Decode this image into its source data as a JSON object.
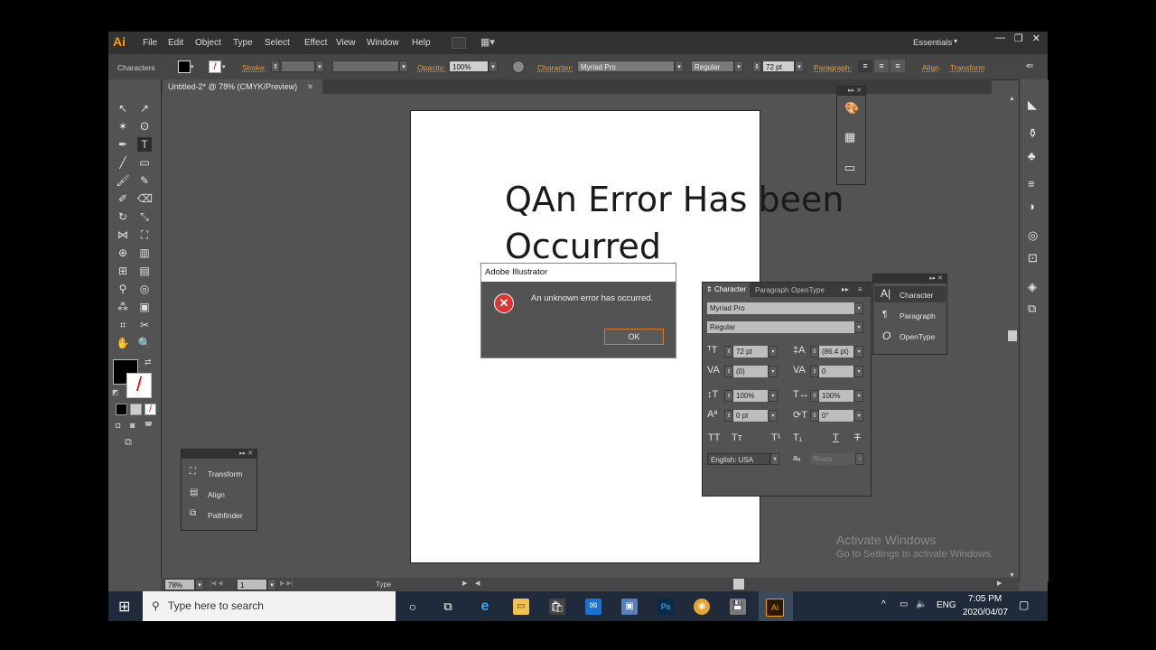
{
  "app": {
    "logo": "Ai",
    "menu": [
      "File",
      "Edit",
      "Object",
      "Type",
      "Select",
      "Effect",
      "View",
      "Window",
      "Help"
    ],
    "workspace": "Essentials",
    "window_controls": [
      "—",
      "❐",
      "✕"
    ]
  },
  "control_bar": {
    "panel_name": "Characters",
    "stroke_label": "Stroke:",
    "opacity_label": "Opacity:",
    "opacity_value": "100%",
    "character_label": "Character:",
    "font": "Myriad Pro",
    "style": "Regular",
    "size": "72 pt",
    "paragraph_label": "Paragraph:",
    "align_label": "Align",
    "transform_label": "Transform"
  },
  "document": {
    "tab_title": "Untitled-2* @ 78% (CMYK/Preview)",
    "art_text": "QAn Error Has been\nOccurred"
  },
  "dialog": {
    "title": "Adobe Illustrator",
    "message": "An unknown error has occurred.",
    "ok": "OK"
  },
  "small_panel": {
    "items": [
      "Transform",
      "Align",
      "Pathfinder"
    ]
  },
  "character_panel": {
    "tabs": [
      "Character",
      "Paragraph",
      "OpenType"
    ],
    "font": "Myriad Pro",
    "style": "Regular",
    "size": "72 pt",
    "leading": "(86.4 pt)",
    "kerning": "(0)",
    "tracking": "0",
    "vscale": "100%",
    "hscale": "100%",
    "baseline": "0 pt",
    "rotation": "0°",
    "language": "English: USA",
    "antialias": "Sharp",
    "tt_buttons": [
      "TT",
      "Tт",
      "T¹",
      "T₁",
      "T",
      "T"
    ]
  },
  "mini_panel": {
    "items": [
      "Character",
      "Paragraph",
      "OpenType"
    ]
  },
  "status": {
    "zoom": "78%",
    "page": "1",
    "tool": "Type"
  },
  "watermark": {
    "line1": "Activate Windows",
    "line2": "Go to Settings to activate Windows."
  },
  "taskbar": {
    "search_placeholder": "Type here to search",
    "lang": "ENG",
    "time": "7:05 PM",
    "date": "2020/04/07"
  }
}
